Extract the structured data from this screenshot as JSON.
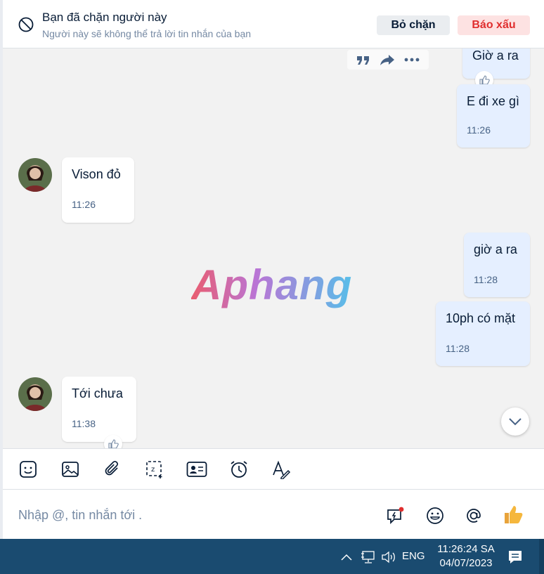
{
  "banner": {
    "title": "Bạn đã chặn người này",
    "subtitle": "Người này sẽ không thể trả lời tin nhắn của bạn",
    "unblock_label": "Bỏ chặn",
    "report_label": "Báo xấu"
  },
  "messages": [
    {
      "side": "mine",
      "text": "Giờ a ra",
      "time": "",
      "reaction": "like"
    },
    {
      "side": "mine",
      "text": "E đi xe gì",
      "time": "11:26"
    },
    {
      "side": "theirs",
      "text": "Vison đỏ",
      "time": "11:26"
    },
    {
      "side": "mine",
      "text": "giờ a ra",
      "time": "11:28"
    },
    {
      "side": "mine",
      "text": "10ph có mặt",
      "time": "11:28"
    },
    {
      "side": "theirs",
      "text": "Tới chưa",
      "time": "11:38",
      "reaction": "like"
    }
  ],
  "watermark": "Aphang",
  "composer": {
    "placeholder": "Nhập @, tin nhắn tới ."
  },
  "taskbar": {
    "language": "ENG",
    "time": "11:26:24 SA",
    "date": "04/07/2023"
  },
  "colors": {
    "my_bubble": "#e5efff",
    "their_bubble": "#ffffff",
    "report_text": "#e02e2e",
    "taskbar": "#1a4b70"
  }
}
